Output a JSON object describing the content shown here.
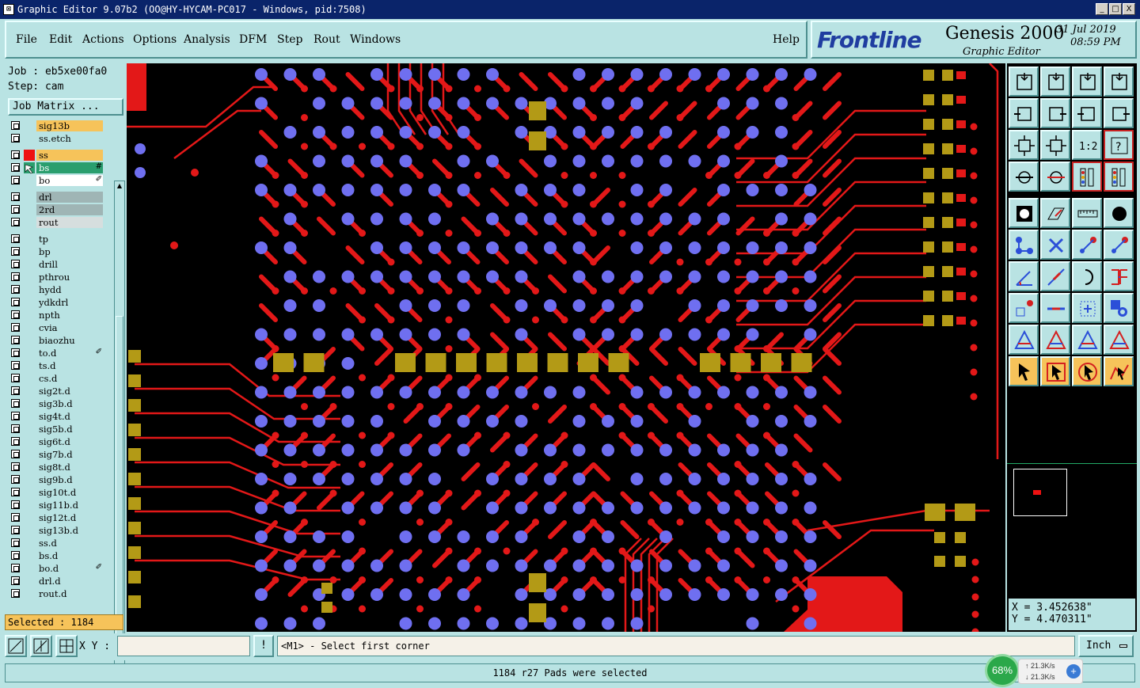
{
  "window": {
    "title": "Graphic Editor 9.07b2 (OO@HY-HYCAM-PC017 - Windows, pid:7508)",
    "min_label": "_",
    "max_label": "□",
    "close_label": "X"
  },
  "menu": {
    "items": [
      "File",
      "Edit",
      "Actions",
      "Options",
      "Analysis",
      "DFM",
      "Step",
      "Rout",
      "Windows"
    ],
    "help": "Help"
  },
  "brand": {
    "logo": "Frontline",
    "product": "Genesis 2000",
    "module": "Graphic Editor",
    "date": "31 Jul 2019",
    "time": "08:59 PM"
  },
  "job": {
    "job_line": "Job : eb5xe00fa0",
    "step_line": "Step: cam",
    "matrix_button": "Job Matrix ..."
  },
  "layers": [
    {
      "name": "sig13b",
      "color": "#f6c35a",
      "mark": ""
    },
    {
      "name": "ss.etch",
      "color": "#b9e3e3",
      "mark": ""
    },
    {
      "name": "ss",
      "color": "#f6c35a",
      "mark": "",
      "swatch": "#e11"
    },
    {
      "name": "bs",
      "color": "#2a9e6e",
      "mark": "#",
      "swatch": "#2a9e6e",
      "arrow": true,
      "text_color": "#fff"
    },
    {
      "name": "bo",
      "color": "#ffffff",
      "mark": "✐"
    },
    {
      "name": "drl",
      "color": "#9fb5b5",
      "mark": ""
    },
    {
      "name": "2rd",
      "color": "#9fb5b5",
      "mark": ""
    },
    {
      "name": "rout",
      "color": "#d6dede",
      "mark": ""
    },
    {
      "name": "tp",
      "color": "#b9e3e3",
      "mark": ""
    },
    {
      "name": "bp",
      "color": "#b9e3e3",
      "mark": ""
    },
    {
      "name": "drill",
      "color": "#b9e3e3",
      "mark": ""
    },
    {
      "name": "pthrou",
      "color": "#b9e3e3",
      "mark": ""
    },
    {
      "name": "hydd",
      "color": "#b9e3e3",
      "mark": ""
    },
    {
      "name": "ydkdrl",
      "color": "#b9e3e3",
      "mark": ""
    },
    {
      "name": "npth",
      "color": "#b9e3e3",
      "mark": ""
    },
    {
      "name": "cvia",
      "color": "#b9e3e3",
      "mark": ""
    },
    {
      "name": "biaozhu",
      "color": "#b9e3e3",
      "mark": ""
    },
    {
      "name": "to.d",
      "color": "#b9e3e3",
      "mark": "✐"
    },
    {
      "name": "ts.d",
      "color": "#b9e3e3",
      "mark": ""
    },
    {
      "name": "cs.d",
      "color": "#b9e3e3",
      "mark": ""
    },
    {
      "name": "sig2t.d",
      "color": "#b9e3e3",
      "mark": ""
    },
    {
      "name": "sig3b.d",
      "color": "#b9e3e3",
      "mark": ""
    },
    {
      "name": "sig4t.d",
      "color": "#b9e3e3",
      "mark": ""
    },
    {
      "name": "sig5b.d",
      "color": "#b9e3e3",
      "mark": ""
    },
    {
      "name": "sig6t.d",
      "color": "#b9e3e3",
      "mark": ""
    },
    {
      "name": "sig7b.d",
      "color": "#b9e3e3",
      "mark": ""
    },
    {
      "name": "sig8t.d",
      "color": "#b9e3e3",
      "mark": ""
    },
    {
      "name": "sig9b.d",
      "color": "#b9e3e3",
      "mark": ""
    },
    {
      "name": "sig10t.d",
      "color": "#b9e3e3",
      "mark": ""
    },
    {
      "name": "sig11b.d",
      "color": "#b9e3e3",
      "mark": ""
    },
    {
      "name": "sig12t.d",
      "color": "#b9e3e3",
      "mark": ""
    },
    {
      "name": "sig13b.d",
      "color": "#b9e3e3",
      "mark": ""
    },
    {
      "name": "ss.d",
      "color": "#b9e3e3",
      "mark": ""
    },
    {
      "name": "bs.d",
      "color": "#b9e3e3",
      "mark": ""
    },
    {
      "name": "bo.d",
      "color": "#b9e3e3",
      "mark": "✐"
    },
    {
      "name": "drl.d",
      "color": "#b9e3e3",
      "mark": ""
    },
    {
      "name": "rout.d",
      "color": "#b9e3e3",
      "mark": ""
    }
  ],
  "selected_count": "Selected : 1184",
  "coords": {
    "x": "X = 3.452638\"",
    "y": "Y = 4.470311\""
  },
  "xy": {
    "label": "X Y :",
    "value": "",
    "info_label": "!"
  },
  "prompt": "<M1> - Select first corner",
  "unit": "Inch",
  "status": "1184 r27 Pads were selected",
  "netmeter": {
    "percent": "68%",
    "up": "21.3K/s",
    "down": "21.3K/s",
    "plus": "+"
  },
  "toolbox": {
    "icons": [
      "snap-icon",
      "snap-grid-icon",
      "home-icon",
      "window-icon",
      "pan-left-icon",
      "pan-right-icon",
      "swap-icon",
      "flip-icon",
      "zoom-fit-icon",
      "zoom-center-icon",
      "zoom-1to1-icon",
      "help-query-icon",
      "measure-probe-icon",
      "pin-icon",
      "layer-stack-icon",
      "layer-stack-alt-icon",
      "feature-fill-icon",
      "rotate-shape-icon",
      "ruler-icon",
      "dot-icon",
      "connect-nodes-icon",
      "cross-node-icon",
      "move-node-icon",
      "link-node-icon",
      "angle-icon",
      "line-icon",
      "arc-icon",
      "split-icon",
      "grid-select-icon",
      "midline-icon",
      "center-icon",
      "dual-circle-icon",
      "triangle-a-icon",
      "triangle-b-icon",
      "triangle-c-icon",
      "triangle-d-icon",
      "select-arrow-icon",
      "select-box-icon",
      "select-circle-icon",
      "select-path-icon"
    ]
  },
  "colors": {
    "trace": "#e31818",
    "pad": "#6f6ff0",
    "smd": "#b39a16",
    "panel": "#b9e3e3"
  }
}
